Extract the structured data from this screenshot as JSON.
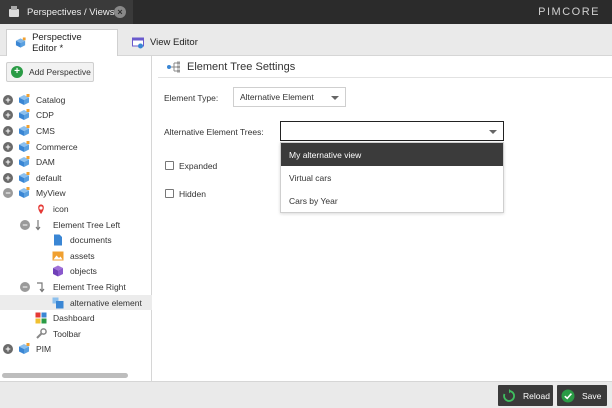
{
  "topbar": {
    "tab_title": "Perspectives / Views",
    "logo": "PIMCORE"
  },
  "editor_tabs": [
    {
      "label": "Perspective Editor *"
    },
    {
      "label": "View Editor"
    }
  ],
  "left": {
    "add_label": "Add Perspective",
    "tree": [
      {
        "label": "Catalog",
        "exp": "+",
        "icon": "perspective-icon"
      },
      {
        "label": "CDP",
        "exp": "+",
        "icon": "perspective-icon"
      },
      {
        "label": "CMS",
        "exp": "+",
        "icon": "perspective-icon"
      },
      {
        "label": "Commerce",
        "exp": "+",
        "icon": "perspective-icon"
      },
      {
        "label": "DAM",
        "exp": "+",
        "icon": "perspective-icon"
      },
      {
        "label": "default",
        "exp": "+",
        "icon": "perspective-icon"
      },
      {
        "label": "MyView",
        "exp": "-",
        "icon": "perspective-icon"
      },
      {
        "label": "icon",
        "icon": "map-pin-icon"
      },
      {
        "label": "Element Tree Left",
        "exp": "-",
        "icon": "arrow-down-icon"
      },
      {
        "label": "documents",
        "icon": "document-icon"
      },
      {
        "label": "assets",
        "icon": "image-icon"
      },
      {
        "label": "objects",
        "icon": "cube-icon"
      },
      {
        "label": "Element Tree Right",
        "exp": "-",
        "icon": "arrow-turn-icon"
      },
      {
        "label": "alternative element",
        "icon": "tree-view-icon",
        "selected": true
      },
      {
        "label": "Dashboard",
        "icon": "dashboard-icon"
      },
      {
        "label": "Toolbar",
        "icon": "wrench-icon"
      },
      {
        "label": "PIM",
        "exp": "+",
        "icon": "perspective-icon"
      }
    ]
  },
  "right": {
    "title": "Element Tree Settings",
    "element_type_label": "Element Type:",
    "element_type_value": "Alternative Element",
    "alt_trees_label": "Alternative Element Trees:",
    "alt_trees_value": "",
    "expanded_label": "Expanded",
    "hidden_label": "Hidden",
    "dropdown_options": [
      "My alternative view",
      "Virtual cars",
      "Cars by Year"
    ]
  },
  "bottom": {
    "reload_label": "Reload",
    "save_label": "Save"
  },
  "colors": {
    "topbar": "#2b2b2b",
    "highlight": "#3b3b3b",
    "accent_green": "#2a9b45"
  }
}
